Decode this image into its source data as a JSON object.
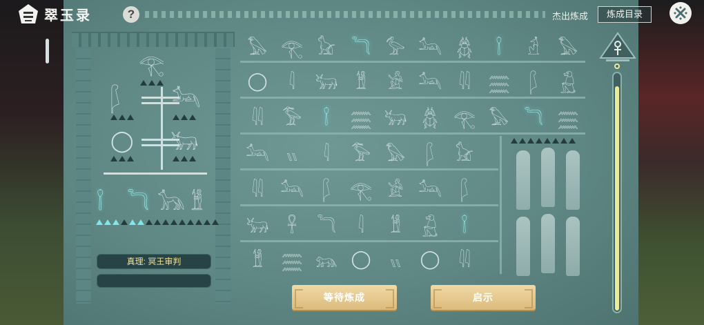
{
  "header": {
    "app_title": "翠玉录",
    "help_label": "?",
    "excellent_label": "杰出炼成",
    "catalog_label": "炼成目录"
  },
  "colors": {
    "panel": "#6f9895",
    "glyph": "#cfe0df",
    "highlight": "#9ff2f0",
    "verdict_text": "#f3e39a",
    "button": "#e8cc8f"
  },
  "tablet": {
    "top_glyph": "eye-of-horus",
    "verdict_text": "真理: 冥王审判",
    "bottom_glyphs": [
      "crossed-staves",
      "serpent",
      "jackal",
      "mummy"
    ]
  },
  "grid": {
    "rows": [
      [
        "bird",
        "eye",
        "seated-cat",
        "serpent",
        "ibis",
        "jackal",
        "scarab",
        "crossed-staves",
        "jackal-head",
        "bird"
      ],
      [
        "ring",
        "reed",
        "bull",
        "mummy",
        "kneeling-man",
        "jackal",
        "reeds",
        "water",
        "feather",
        "baboon"
      ],
      [
        "reeds",
        "heron",
        "crossed-staves",
        "water",
        "bull",
        "scarab",
        "eye",
        "bird",
        "serpent",
        "water"
      ],
      [
        "jackal",
        "pair",
        "reed",
        "heron",
        "bird",
        "feather",
        "seated-cat"
      ],
      [
        "reeds",
        "jackal",
        "feather",
        "eye",
        "kneeling-man",
        "jackal",
        "feather"
      ],
      [
        "bull",
        "ankh-pair",
        "serpent",
        "reed",
        "mummy",
        "baboon",
        "crossed-staves"
      ],
      [
        "mummy",
        "water",
        "lion",
        "ring",
        "pair",
        "ring",
        "reeds"
      ]
    ],
    "highlighted": [
      {
        "row": 0,
        "col": 3
      },
      {
        "row": 0,
        "col": 7
      },
      {
        "row": 2,
        "col": 2
      },
      {
        "row": 2,
        "col": 8
      },
      {
        "row": 5,
        "col": 6
      }
    ]
  },
  "slider": {
    "level": 0.95
  },
  "actions": {
    "wait_label": "等待炼成",
    "hint_label": "启示"
  }
}
